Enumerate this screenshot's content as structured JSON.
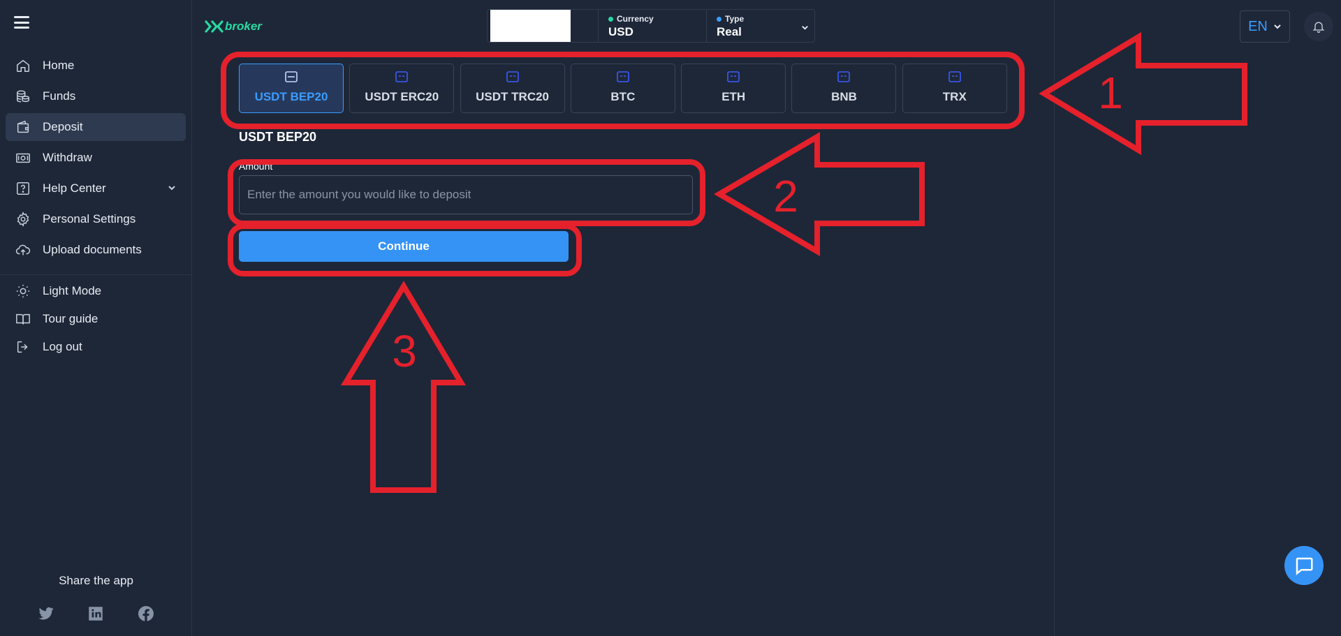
{
  "sidebar": {
    "items": [
      {
        "label": "Home",
        "icon": "home-icon"
      },
      {
        "label": "Funds",
        "icon": "coins-icon"
      },
      {
        "label": "Deposit",
        "icon": "wallet-icon"
      },
      {
        "label": "Withdraw",
        "icon": "cash-icon"
      },
      {
        "label": "Help Center",
        "icon": "help-icon"
      },
      {
        "label": "Personal Settings",
        "icon": "gear-icon"
      },
      {
        "label": "Upload documents",
        "icon": "cloud-upload-icon"
      }
    ],
    "secondary": [
      {
        "label": "Light Mode",
        "icon": "sun-icon"
      },
      {
        "label": "Tour guide",
        "icon": "book-icon"
      },
      {
        "label": "Log out",
        "icon": "logout-icon"
      }
    ],
    "share_label": "Share the app"
  },
  "header": {
    "logo_text": "broker",
    "currency_label": "Currency",
    "currency_value": "USD",
    "type_label": "Type",
    "type_value": "Real",
    "lang": "EN"
  },
  "deposit": {
    "tabs": [
      "USDT BEP20",
      "USDT ERC20",
      "USDT TRC20",
      "BTC",
      "ETH",
      "BNB",
      "TRX"
    ],
    "selected": "USDT BEP20",
    "section_title": "USDT BEP20",
    "amount_label": "Amount",
    "amount_placeholder": "Enter the amount you would like to deposit",
    "continue_label": "Continue"
  },
  "annotations": [
    "1",
    "2",
    "3"
  ],
  "colors": {
    "background": "#1e2738",
    "accent": "#3593f6",
    "brand": "#27d9a2",
    "annotation": "#e5212c"
  }
}
